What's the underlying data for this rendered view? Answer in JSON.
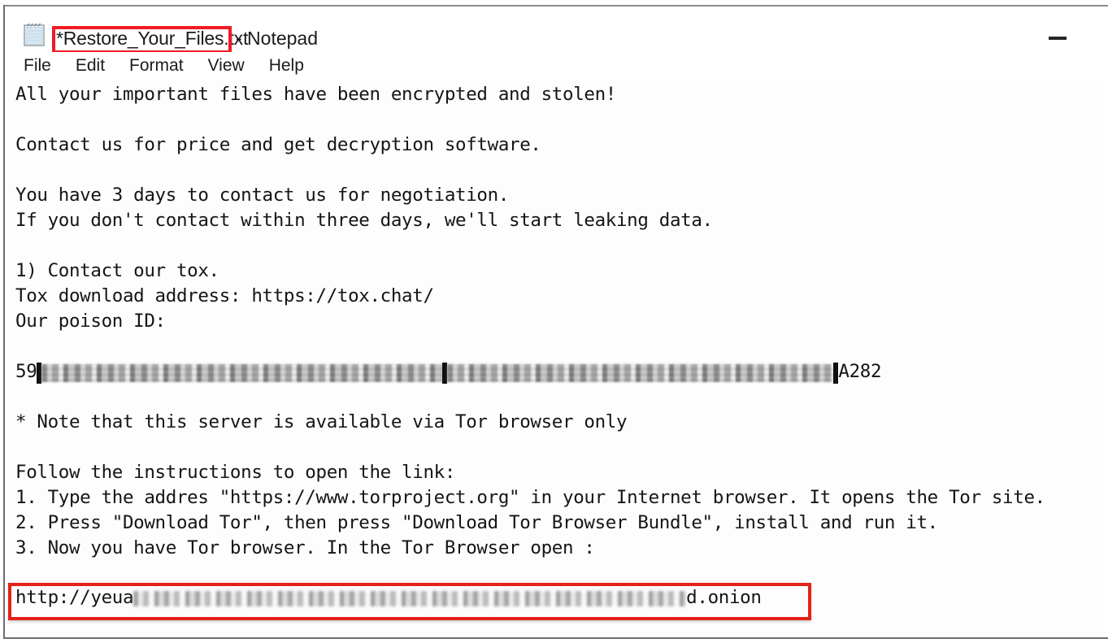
{
  "window": {
    "title_filename": "*Restore_Your_Files.txt",
    "title_suffix": "- Notepad",
    "icon": "notepad-icon",
    "minimize_label": "Minimize",
    "highlight_color": "#ee1c25"
  },
  "menu": {
    "items": [
      {
        "label": "File"
      },
      {
        "label": "Edit"
      },
      {
        "label": "Format"
      },
      {
        "label": "View"
      },
      {
        "label": "Help"
      }
    ]
  },
  "document": {
    "lines": [
      {
        "text": "All your important files have been encrypted and stolen!"
      },
      {
        "text": ""
      },
      {
        "text": "Contact us for price and get decryption software."
      },
      {
        "text": ""
      },
      {
        "text": "You have 3 days to contact us for negotiation."
      },
      {
        "text": "If you don't contact within three days, we'll start leaking data."
      },
      {
        "text": ""
      },
      {
        "text": "1) Contact our tox."
      },
      {
        "text": "Tox download address: https://tox.chat/"
      },
      {
        "text": "Our poison ID:"
      },
      {
        "text": ""
      },
      {
        "type": "redacted",
        "prefix": "59",
        "suffix": "A282"
      },
      {
        "text": ""
      },
      {
        "text": "* Note that this server is available via Tor browser only"
      },
      {
        "text": ""
      },
      {
        "text": "Follow the instructions to open the link:"
      },
      {
        "text": "1. Type the addres \"https://www.torproject.org\" in your Internet browser. It opens the Tor site."
      },
      {
        "text": "2. Press \"Download Tor\", then press \"Download Tor Browser Bundle\", install and run it."
      },
      {
        "text": "3. Now you have Tor browser. In the Tor Browser open :"
      },
      {
        "text": ""
      }
    ],
    "onion_url": {
      "prefix": "http://yeua",
      "suffix": "d.onion",
      "highlight_color": "#e32219"
    }
  }
}
